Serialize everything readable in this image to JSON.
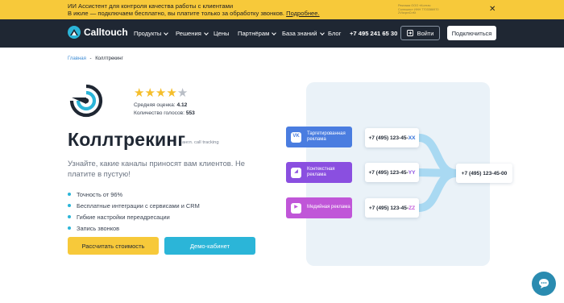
{
  "banner": {
    "line1": "ИИ Ассистент для контроля качества работы с клиентами",
    "line2_prefix": "В июле — подключаем бесплатно, вы платите только за обработку звонков. ",
    "line2_link": "Подробнее.",
    "ad_line1": "Реклама ООО «Колтач",
    "ad_line2": "Солюшнс» ИНН 7703386970",
    "ad_line3": "2VtzqxnCnKt",
    "close_icon": "close-icon"
  },
  "header": {
    "logo_text": "Calltouch",
    "nav": [
      "Продукты",
      "Решения",
      "Цены",
      "Партнёрам",
      "База знаний",
      "Блог"
    ],
    "phone": "+7 495 241 65 30",
    "login_label": "Войти",
    "connect_label": "Подключиться"
  },
  "breadcrumb": {
    "home": "Главная",
    "separator": "-",
    "current": "Коллтрекинг"
  },
  "rating": {
    "stars_total": 5,
    "stars_filled": 4,
    "avg_label": "Средняя оценка:",
    "avg_value": "4.12",
    "votes_label": "Количество голосов:",
    "votes_value": "553"
  },
  "hero": {
    "title": "Коллтрекинг",
    "title_sub": "англ. call tracking",
    "lead": "Узнайте, какие каналы приносят вам клиентов. Не платите в пустую!",
    "bullets": [
      "Точность от 96%",
      "Бесплатные интеграции с сервисами и CRM",
      "Гибкие настройки переадресации",
      "Запись звонков"
    ],
    "calc_label": "Рассчитать стоимость",
    "demo_label": "Демо-кабинет"
  },
  "diagram": {
    "channels": [
      {
        "name": "Таргетированная реклама",
        "icon": "vk-icon",
        "icon_text": "VK",
        "color": "#4a7de0"
      },
      {
        "name": "Контекстная реклама",
        "icon": "yandex-direct-icon",
        "icon_text": "◢",
        "color": "#8a4fe0"
      },
      {
        "name": "Медийная реклама",
        "icon": "play-icon",
        "icon_text": "▶",
        "color": "#c056d8"
      }
    ],
    "numbers": [
      {
        "prefix": "+7 (495) 123-45-",
        "suffix": "XX",
        "suffix_color": "#2f6fd8"
      },
      {
        "prefix": "+7 (495) 123-45-",
        "suffix": "YY",
        "suffix_color": "#8a4fe0"
      },
      {
        "prefix": "+7 (495) 123-45-",
        "suffix": "ZZ",
        "suffix_color": "#c056d8"
      }
    ],
    "main_number": "+7 (495) 123-45-00"
  },
  "chat_icon": "chat-icon",
  "colors": {
    "accent_yellow": "#f7c93a",
    "accent_cyan": "#2bb5d8",
    "dark": "#1f2733"
  }
}
